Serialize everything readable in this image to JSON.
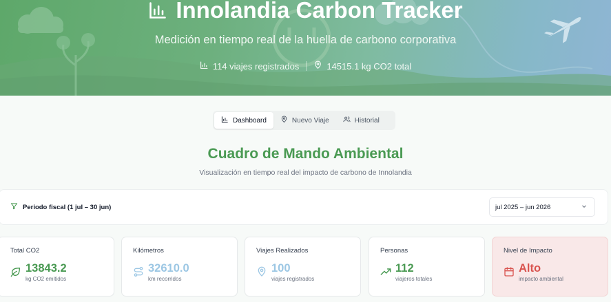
{
  "header": {
    "title": "Innolandia Carbon Tracker",
    "subtitle": "Medición en tiempo real de la huella de carbono corporativa",
    "stats": [
      {
        "icon": "bar-chart-icon",
        "text": "114 viajes registrados"
      },
      {
        "icon": "map-pin-icon",
        "text": "14515.1 kg CO2 total"
      }
    ]
  },
  "tabs": [
    {
      "label": "Dashboard",
      "icon": "bar-chart-icon",
      "active": true
    },
    {
      "label": "Nuevo Viaje",
      "icon": "map-pin-icon",
      "active": false
    },
    {
      "label": "Historial",
      "icon": "users-icon",
      "active": false
    }
  ],
  "dashboard": {
    "title": "Cuadro de Mando Ambiental",
    "subtitle": "Visualización en tiempo real del impacto de carbono de Innolandia"
  },
  "filter": {
    "label": "Periodo fiscal (1 jul – 30 jun)",
    "selected": "jul 2025 – jun 2026"
  },
  "cards": [
    {
      "label": "Total CO2",
      "value": "13843.2",
      "unit": "kg CO2 emitidos",
      "icon": "leaf-icon",
      "color": "#4a9a53"
    },
    {
      "label": "Kilómetros",
      "value": "32610.0",
      "unit": "km recorridos",
      "icon": "route-icon",
      "color": "#9cc7e4"
    },
    {
      "label": "Viajes Realizados",
      "value": "100",
      "unit": "viajes registrados",
      "icon": "map-pin-icon",
      "color": "#9cc7e4"
    },
    {
      "label": "Personas",
      "value": "112",
      "unit": "viajeros totales",
      "icon": "trending-up-icon",
      "color": "#4a9a53"
    },
    {
      "label": "Nivel de Impacto",
      "value": "Alto",
      "unit": "impacto ambiental",
      "icon": "calendar-icon",
      "color": "#d9534f"
    }
  ],
  "colors": {
    "primary": "#4a9a53",
    "accent_blue": "#9cc7e4",
    "danger": "#d9534f",
    "impact_bg": "#f9e8e8"
  }
}
